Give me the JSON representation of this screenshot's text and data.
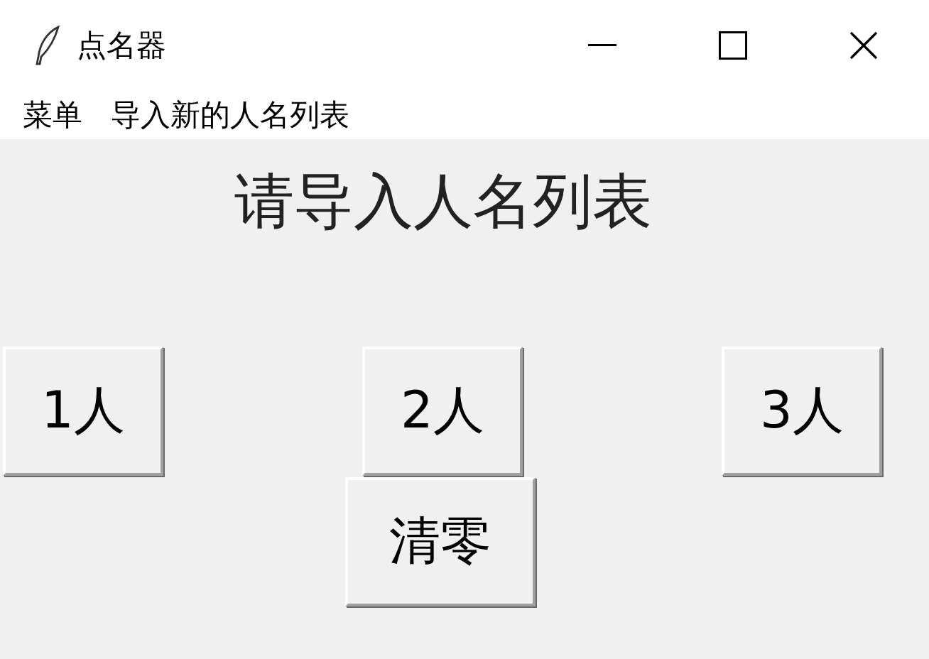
{
  "window": {
    "title": "点名器"
  },
  "menu": [
    "菜单",
    "导入新的人名列表"
  ],
  "heading": "请导入人名列表",
  "count_buttons": [
    "1人",
    "2人",
    "3人"
  ],
  "clear_button": "清零"
}
